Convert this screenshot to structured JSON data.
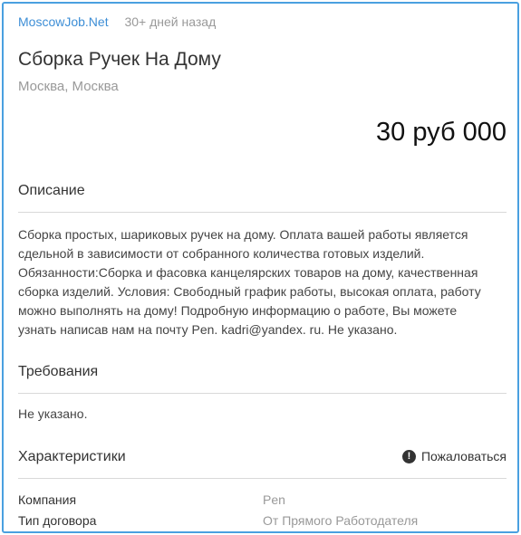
{
  "header": {
    "source": "MoscowJob.Net",
    "posted": "30+ дней назад",
    "title": "Сборка Ручек На Дому",
    "location": "Москва, Москва",
    "salary": "30 руб 000"
  },
  "description": {
    "heading": "Описание",
    "text": "Сборка простых, шариковых ручек на дому. Оплата вашей работы является сдельной в зависимости от собранного количества готовых изделий. Обязанности:Сборка и фасовка канцелярских товаров на дому, качественная сборка изделий. Условия: Свободный график работы, высокая оплата, работу можно выполнять на дому! Подробную информацию о работе, Вы можете узнать написав нам на почту Pen. kadri@yandex. ru. Не указано."
  },
  "requirements": {
    "heading": "Требования",
    "text": "Не указано."
  },
  "characteristics": {
    "heading": "Характеристики",
    "report_label": "Пожаловаться",
    "report_icon": "exclamation-circle-icon",
    "rows": [
      {
        "key": "Компания",
        "value": "Pen"
      },
      {
        "key": "Тип договора",
        "value": "От Прямого Работодателя"
      }
    ]
  },
  "colors": {
    "frame_border": "#4aa0e0",
    "link": "#3d8ed6",
    "muted": "#999999"
  }
}
